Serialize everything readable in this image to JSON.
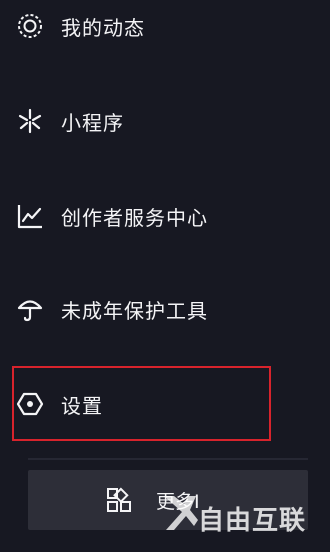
{
  "menu": {
    "items": [
      {
        "label": "我的动态",
        "icon": "target-circle-icon"
      },
      {
        "label": "小程序",
        "icon": "asterisk-icon"
      },
      {
        "label": "创作者服务中心",
        "icon": "line-chart-icon"
      },
      {
        "label": "未成年保护工具",
        "icon": "umbrella-icon"
      },
      {
        "label": "设置",
        "icon": "hexagon-settings-icon"
      }
    ],
    "highlight_color": "#d8232c"
  },
  "more_button": {
    "label": "更多I",
    "icon": "grid-icon"
  },
  "watermark": {
    "text": "自由互联"
  },
  "colors": {
    "background": "#171822",
    "button_bg": "#2d2e38",
    "text": "#f4f4f6"
  }
}
